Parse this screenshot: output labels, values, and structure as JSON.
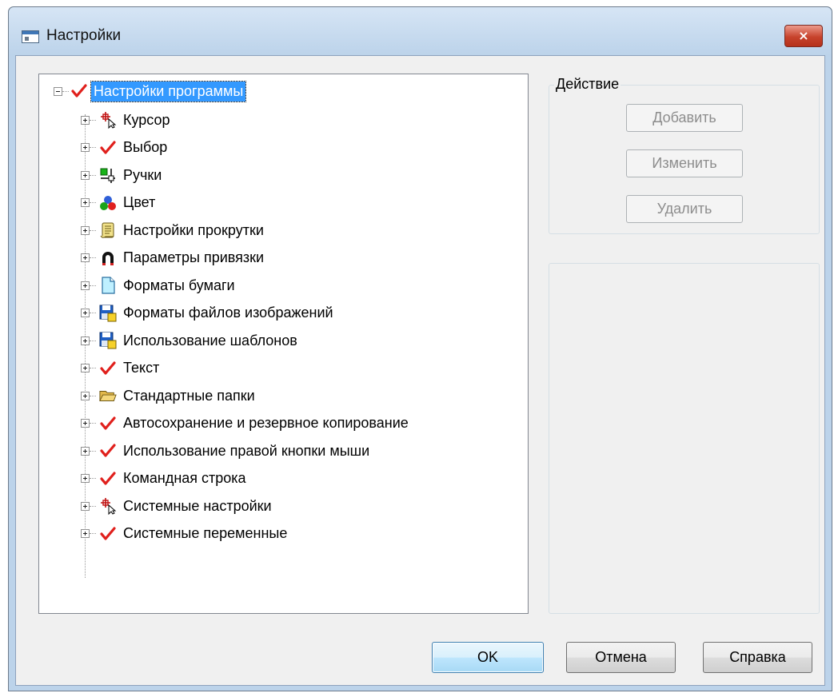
{
  "window": {
    "title": "Настройки",
    "close_label": "×"
  },
  "tree": {
    "root": {
      "label": "Настройки программы",
      "icon": "check-icon"
    },
    "items": [
      {
        "label": "Курсор",
        "icon": "cursor-icon"
      },
      {
        "label": "Выбор",
        "icon": "check-icon"
      },
      {
        "label": "Ручки",
        "icon": "grips-icon"
      },
      {
        "label": "Цвет",
        "icon": "color-icon"
      },
      {
        "label": "Настройки прокрутки",
        "icon": "scroll-icon"
      },
      {
        "label": "Параметры привязки",
        "icon": "magnet-icon"
      },
      {
        "label": "Форматы бумаги",
        "icon": "paper-icon"
      },
      {
        "label": "Форматы файлов изображений",
        "icon": "floppy-icon"
      },
      {
        "label": "Использование шаблонов",
        "icon": "floppy-icon"
      },
      {
        "label": "Текст",
        "icon": "check-icon"
      },
      {
        "label": "Стандартные папки",
        "icon": "folder-icon"
      },
      {
        "label": "Автосохранение и резервное копирование",
        "icon": "check-icon"
      },
      {
        "label": "Использование правой кнопки мыши",
        "icon": "check-icon"
      },
      {
        "label": "Командная строка",
        "icon": "check-icon"
      },
      {
        "label": "Системные настройки",
        "icon": "cursor-icon"
      },
      {
        "label": "Системные переменные",
        "icon": "check-icon"
      }
    ]
  },
  "action_group": {
    "title": "Действие",
    "add_label": "Добавить",
    "edit_label": "Изменить",
    "delete_label": "Удалить"
  },
  "footer": {
    "ok_label": "OK",
    "cancel_label": "Отмена",
    "help_label": "Справка"
  },
  "colors": {
    "selection": "#3399ff",
    "check": "#e0201c"
  }
}
